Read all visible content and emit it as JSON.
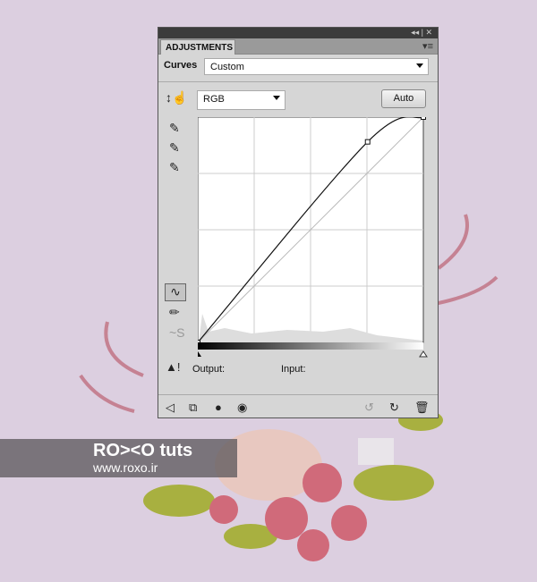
{
  "panel": {
    "title": "ADJUSTMENTS",
    "collapse_icon": "double-chevron-icon",
    "close_icon": "close-icon",
    "menu_icon": "panel-menu-icon",
    "adjustment_label": "Curves",
    "preset_value": "Custom",
    "channel_value": "RGB",
    "auto_label": "Auto",
    "output_label": "Output:",
    "input_label": "Input:"
  },
  "curve": {
    "channel": "RGB",
    "points": [
      [
        0,
        0
      ],
      [
        192,
        227
      ],
      [
        255,
        255
      ]
    ],
    "range": [
      0,
      255
    ]
  },
  "watermark": {
    "brand": "RO><O tuts",
    "url": "www.roxo.ir"
  },
  "colors": {
    "background": "#dccfe0",
    "panel": "#d6d6d6"
  }
}
